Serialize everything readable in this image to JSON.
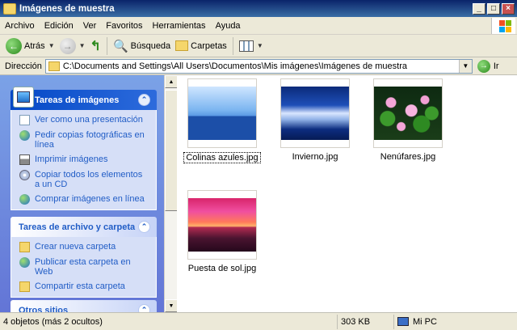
{
  "window": {
    "title": "Imágenes de muestra"
  },
  "menu": [
    "Archivo",
    "Edición",
    "Ver",
    "Favoritos",
    "Herramientas",
    "Ayuda"
  ],
  "toolbar": {
    "back": "Atrás",
    "search": "Búsqueda",
    "folders": "Carpetas"
  },
  "address": {
    "label": "Dirección",
    "path": "C:\\Documents and Settings\\All Users\\Documentos\\Mis imágenes\\Imágenes de muestra",
    "go": "Ir"
  },
  "tasks_images": {
    "title": "Tareas de imágenes",
    "items": [
      "Ver como una presentación",
      "Pedir copias fotográficas en línea",
      "Imprimir imágenes",
      "Copiar todos los elementos a un CD",
      "Comprar imágenes en línea"
    ]
  },
  "tasks_files": {
    "title": "Tareas de archivo y carpeta",
    "items": [
      "Crear nueva carpeta",
      "Publicar esta carpeta en Web",
      "Compartir esta carpeta"
    ]
  },
  "other_places": {
    "title": "Otros sitios"
  },
  "files": [
    {
      "name": "Colinas azules.jpg",
      "kind": "hills",
      "selected": true
    },
    {
      "name": "Invierno.jpg",
      "kind": "winter"
    },
    {
      "name": "Nenúfares.jpg",
      "kind": "lilies"
    },
    {
      "name": "Puesta de sol.jpg",
      "kind": "sunset"
    }
  ],
  "status": {
    "objects": "4 objetos (más 2 ocultos)",
    "size": "303 KB",
    "location": "Mi PC"
  }
}
